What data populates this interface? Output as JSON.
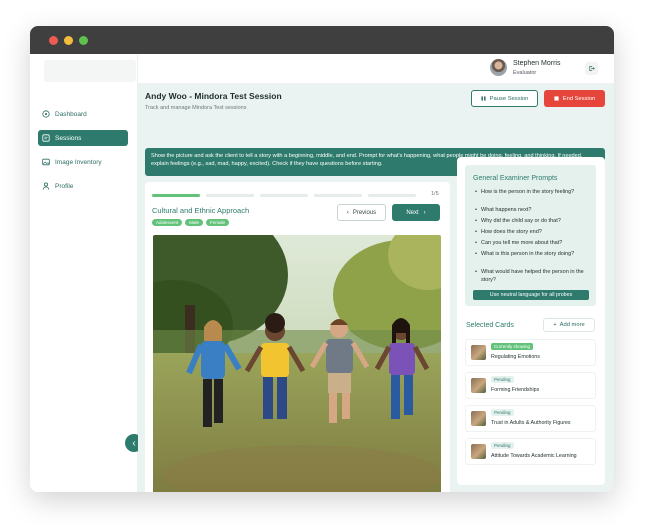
{
  "session": {
    "title": "Andy  Woo - Mindora Test Session",
    "subtitle": "Track and manage Mindora Test sessions",
    "pause_label": "Pause Session",
    "end_label": "End Session"
  },
  "user": {
    "name": "Stephen Morris",
    "role": "Evaluator"
  },
  "sidebar": {
    "items": [
      {
        "label": "Dashboard",
        "icon": "dashboard-icon",
        "active": false
      },
      {
        "label": "Sessions",
        "icon": "sessions-icon",
        "active": true
      },
      {
        "label": "Image Inventory",
        "icon": "image-icon",
        "active": false
      },
      {
        "label": "Profile",
        "icon": "user-icon",
        "active": false
      }
    ]
  },
  "instructions": "Show the picture and ask the client to tell a story with a beginning, middle, and end. Prompt for what's happening, what people might be doing, feeling, and thinking. If needed, explain feelings (e.g., sad, mad, happy, excited). Check if they have questions before starting.",
  "card": {
    "progress_text": "1/5",
    "progress": {
      "current": 1,
      "total": 5
    },
    "title": "Cultural and Ethnic Approach",
    "tags": [
      "Adolescent",
      "Male",
      "Female"
    ],
    "prev_label": "Previous",
    "next_label": "Next"
  },
  "prompts": {
    "title": "General Examiner Prompts",
    "items": [
      "How is the person in the story feeling?",
      "What happens next?",
      "Why did the child say or do that?",
      "How does the story end?",
      "Can you tell me more about that?",
      "What is this person in the story doing?",
      "What would have helped the person in the story?"
    ],
    "neutral_label": "Use neutral language for all probes"
  },
  "selected": {
    "title": "Selected Cards",
    "add_label": "Add more",
    "cards": [
      {
        "status": "Currently showing",
        "label": "Regulating Emotions"
      },
      {
        "status": "Pending",
        "label": "Forming Friendships"
      },
      {
        "status": "Pending",
        "label": "Trust in Adults & Authority Figures"
      },
      {
        "status": "Pending",
        "label": "Attitude Towards Academic Learning"
      }
    ]
  },
  "colors": {
    "accent": "#2e7b6d",
    "danger": "#e5453b",
    "tag": "#62c27a",
    "panel": "#eaf3f1"
  }
}
